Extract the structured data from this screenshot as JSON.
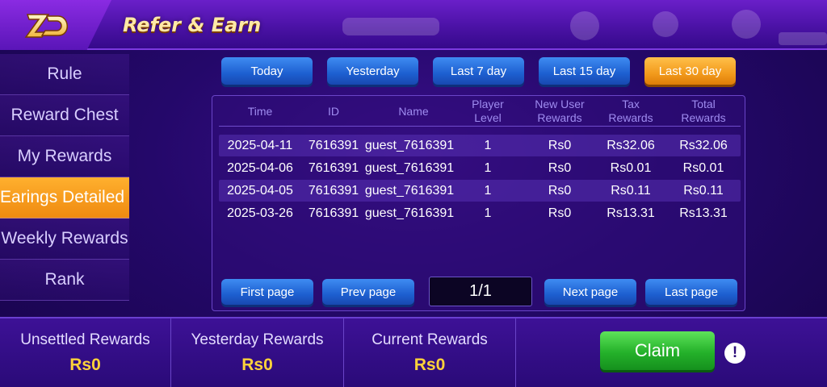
{
  "header": {
    "title": "Refer & Earn",
    "logo_icon": "zd-logo-icon"
  },
  "sidebar": {
    "items": [
      {
        "label": "Rule"
      },
      {
        "label": "Reward Chest"
      },
      {
        "label": "My Rewards"
      },
      {
        "label": "Earings Detailed",
        "active": true
      },
      {
        "label": "Weekly Rewards"
      },
      {
        "label": "Rank"
      }
    ]
  },
  "filters": {
    "selected": "Last 30 day",
    "items": [
      "Today",
      "Yesterday",
      "Last 7 day",
      "Last 15 day",
      "Last 30 day"
    ]
  },
  "table": {
    "headers": {
      "time": "Time",
      "id": "ID",
      "name": "Name",
      "player_level": "Player Level",
      "new_user_rewards": "New User Rewards",
      "tax_rewards": "Tax Rewards",
      "total_rewards": "Total Rewards"
    },
    "rows": [
      {
        "time": "2025-04-11",
        "id": "7616391",
        "name": "guest_7616391",
        "level": "1",
        "new_user": "Rs0",
        "tax": "Rs32.06",
        "total": "Rs32.06"
      },
      {
        "time": "2025-04-06",
        "id": "7616391",
        "name": "guest_7616391",
        "level": "1",
        "new_user": "Rs0",
        "tax": "Rs0.01",
        "total": "Rs0.01"
      },
      {
        "time": "2025-04-05",
        "id": "7616391",
        "name": "guest_7616391",
        "level": "1",
        "new_user": "Rs0",
        "tax": "Rs0.11",
        "total": "Rs0.11"
      },
      {
        "time": "2025-03-26",
        "id": "7616391",
        "name": "guest_7616391",
        "level": "1",
        "new_user": "Rs0",
        "tax": "Rs13.31",
        "total": "Rs13.31"
      }
    ]
  },
  "pagination": {
    "first": "First page",
    "prev": "Prev page",
    "indicator": "1/1",
    "next": "Next page",
    "last": "Last page"
  },
  "stats": {
    "unsettled": {
      "label": "Unsettled Rewards",
      "value": "Rs0"
    },
    "yesterday": {
      "label": "Yesterday Rewards",
      "value": "Rs0"
    },
    "current": {
      "label": "Current Rewards",
      "value": "Rs0"
    }
  },
  "claim": {
    "label": "Claim"
  },
  "colors": {
    "accent_orange": "#f29a1c",
    "button_blue": "#1d5fd0",
    "claim_green": "#24b12a",
    "value_yellow": "#ffd23a"
  }
}
